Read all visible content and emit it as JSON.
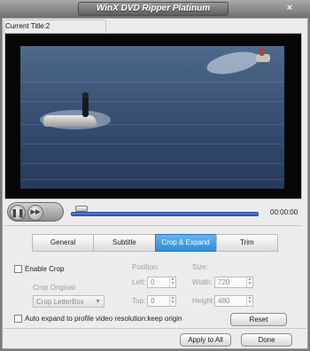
{
  "window": {
    "title": "WinX DVD Ripper Platinum",
    "close_glyph": "×"
  },
  "current_title": "Current Title:2",
  "player": {
    "pause_glyph": "❚❚",
    "forward_glyph": "▶▶",
    "time": "00:00:00",
    "progress_fraction": 0.0
  },
  "tabs": [
    {
      "label": "General",
      "active": false
    },
    {
      "label": "Subtitle",
      "active": false
    },
    {
      "label": "Crop & Expand",
      "active": true
    },
    {
      "label": "Trim",
      "active": false
    }
  ],
  "crop": {
    "enable_label": "Enable Crop",
    "enable_checked": false,
    "crop_original_label": "Crop Original:",
    "crop_original_value": "Crop LetterBox",
    "position_label": "Position:",
    "size_label": "Size:",
    "left_label": "Left:",
    "left_value": "0",
    "top_label": "Top:",
    "top_value": "0",
    "width_label": "Width:",
    "width_value": "720",
    "height_label": "Height:",
    "height_value": "480",
    "auto_expand_label": "Auto expand to profile video resolution:keep origin",
    "auto_expand_checked": false,
    "reset_label": "Reset"
  },
  "footer": {
    "apply_all_label": "Apply to All",
    "done_label": "Done"
  },
  "colors": {
    "accent_tab": "#3a95dc",
    "progress": "#3a72d0"
  },
  "icons": {
    "pause": "pause-icon",
    "forward": "fast-forward-icon",
    "close": "close-icon",
    "dropdown": "chevron-down-icon"
  }
}
